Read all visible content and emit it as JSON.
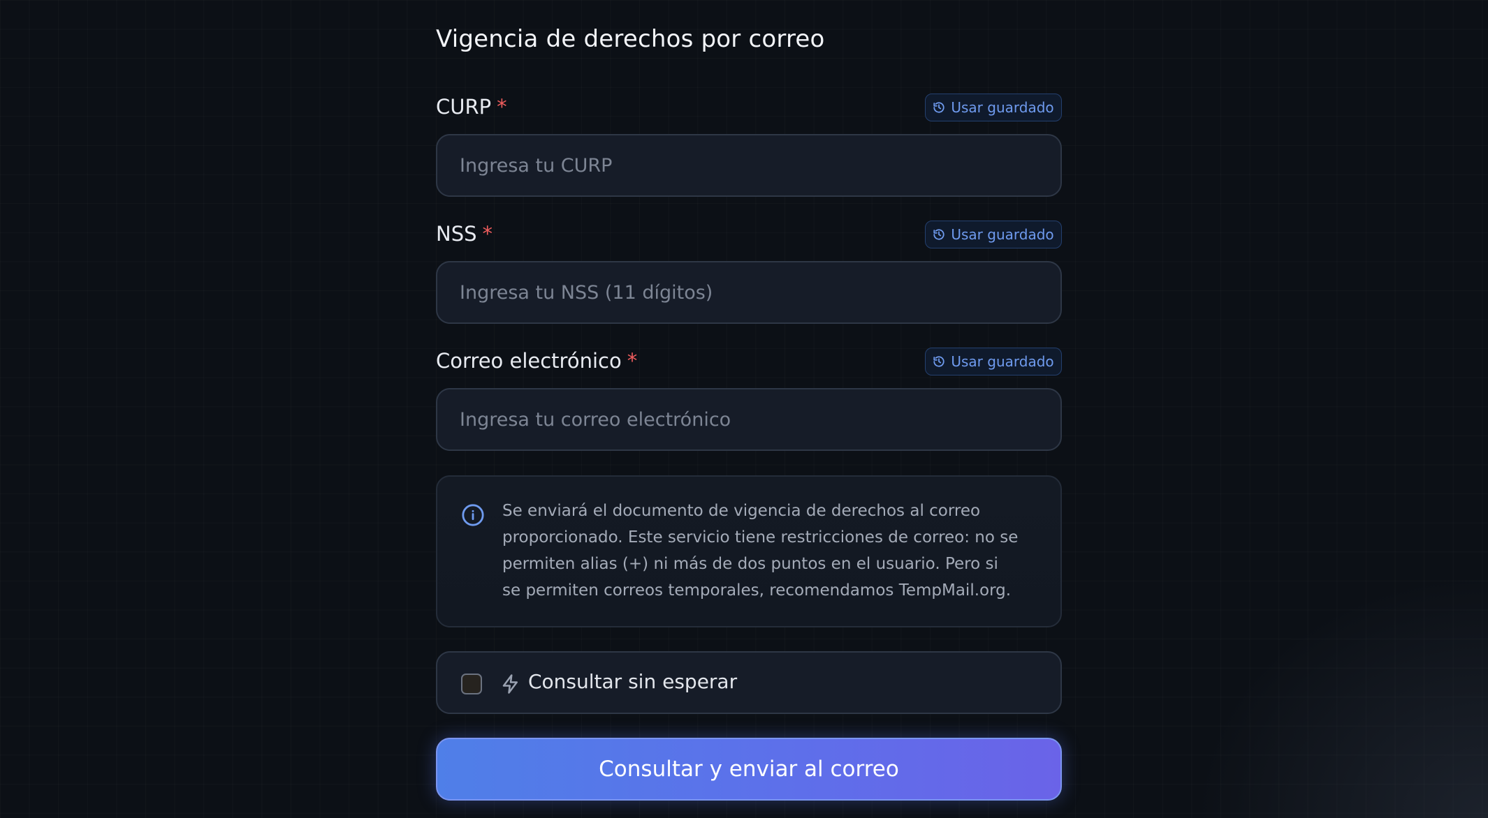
{
  "form": {
    "title": "Vigencia de derechos por correo",
    "required_marker": "*",
    "fields": [
      {
        "label": "CURP",
        "placeholder": "Ingresa tu CURP",
        "value": "",
        "saved_button": "Usar guardado"
      },
      {
        "label": "NSS",
        "placeholder": "Ingresa tu NSS (11 dígitos)",
        "value": "",
        "saved_button": "Usar guardado"
      },
      {
        "label": "Correo electrónico",
        "placeholder": "Ingresa tu correo electrónico",
        "value": "",
        "saved_button": "Usar guardado"
      }
    ],
    "info": {
      "icon": "info-icon",
      "text": "Se enviará el documento de vigencia de derechos al correo proporcionado. Este servicio tiene restricciones de correo: no se permiten alias (+) ni más de dos puntos en el usuario. Pero si se permiten correos temporales, recomendamos TempMail.org."
    },
    "skip_wait": {
      "label": "Consultar sin esperar",
      "checked": false,
      "icon": "bolt-icon"
    },
    "submit_label": "Consultar y enviar al correo"
  },
  "colors": {
    "background": "#0c1016",
    "accent": "#5b7cea",
    "required": "#ef5d5d",
    "saved_button_text": "#6f9bef"
  }
}
